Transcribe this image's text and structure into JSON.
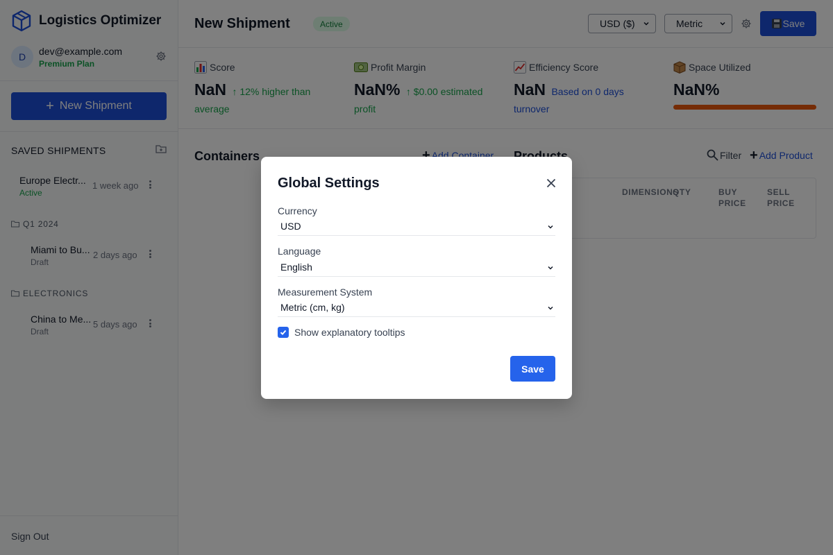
{
  "app": {
    "title": "Logistics Optimizer",
    "logo_icon": "cube-icon"
  },
  "user": {
    "avatar_initial": "D",
    "email": "dev@example.com",
    "plan": "Premium Plan"
  },
  "sidebar": {
    "new_shipment_label": "New Shipment",
    "saved_heading": "SAVED SHIPMENTS",
    "items": [
      {
        "name": "Europe Electr...",
        "status": "Active",
        "time": "1 week ago"
      }
    ],
    "folders": [
      {
        "name": "Q1 2024",
        "items": [
          {
            "name": "Miami to Bu...",
            "status": "Draft",
            "time": "2 days ago"
          }
        ]
      },
      {
        "name": "ELECTRONICS",
        "items": [
          {
            "name": "China to Me...",
            "status": "Draft",
            "time": "5 days ago"
          }
        ]
      }
    ],
    "sign_out": "Sign Out"
  },
  "header": {
    "title": "New Shipment",
    "status": "Active",
    "currency_select": "USD ($)",
    "units_select": "Metric",
    "save_label": "Save"
  },
  "stats": [
    {
      "icon": "bar-chart-icon",
      "label": "Score",
      "value": "NaN",
      "note": "↑ 12% higher than average",
      "note_color": "#16a34a"
    },
    {
      "icon": "money-icon",
      "label": "Profit Margin",
      "value": "NaN%",
      "note": "↑ $0.00 estimated profit",
      "note_color": "#16a34a"
    },
    {
      "icon": "trend-up-icon",
      "label": "Efficiency Score",
      "value": "NaN",
      "note": "Based on 0 days turnover",
      "note_color": "#1d4ed8"
    },
    {
      "icon": "package-icon",
      "label": "Space Utilized",
      "value": "NaN%",
      "note": "",
      "bar_color": "#ea580c"
    }
  ],
  "containers": {
    "title": "Containers",
    "add_label": "Add Container"
  },
  "products": {
    "title": "Products",
    "filter_label": "Filter",
    "add_label": "Add Product",
    "columns": [
      "DIMENSIONS",
      "QTY",
      "BUY PRICE",
      "SELL PRICE"
    ]
  },
  "modal": {
    "title": "Global Settings",
    "currency": {
      "label": "Currency",
      "value": "USD"
    },
    "language": {
      "label": "Language",
      "value": "English"
    },
    "measurement": {
      "label": "Measurement System",
      "value": "Metric (cm, kg)"
    },
    "tooltips": {
      "label": "Show explanatory tooltips",
      "checked": true
    },
    "save_label": "Save"
  },
  "colors": {
    "primary": "#1d4ed8",
    "modal_primary": "#2563eb",
    "success": "#16a34a",
    "warning": "#ea580c"
  }
}
